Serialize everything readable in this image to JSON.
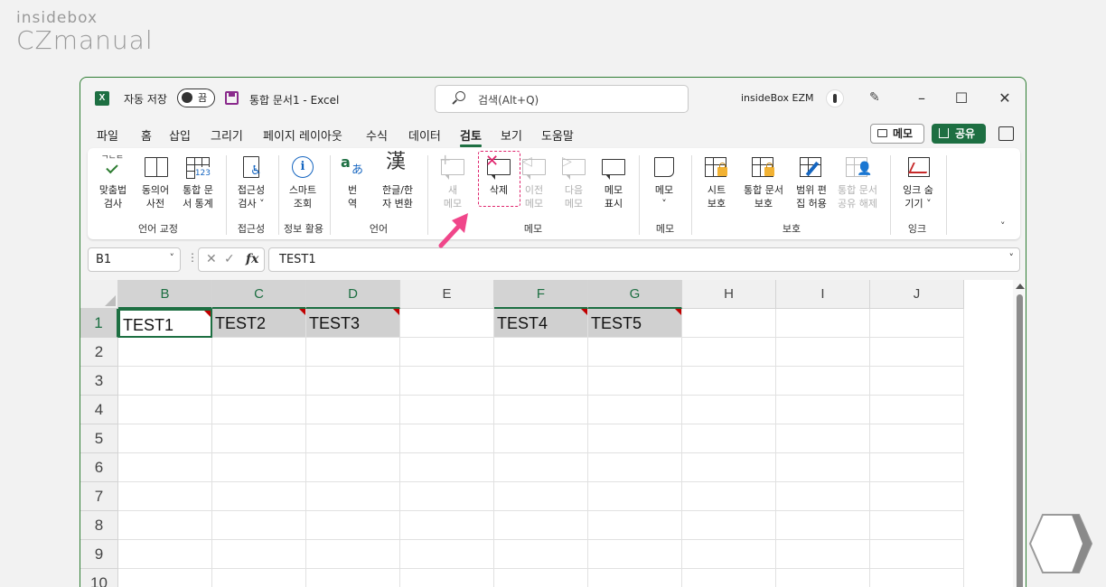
{
  "watermark": {
    "top": "insidebox",
    "main": "CZmanual"
  },
  "titlebar": {
    "app_icon": "X",
    "autosave_label": "자동 저장",
    "autosave_state": "끔",
    "doc_title": "통합 문서1  -  Excel",
    "search_placeholder": "검색(Alt+Q)",
    "user_name": "insideBox EZM",
    "minimize": "–",
    "maximize": "☐",
    "close": "✕"
  },
  "tabs": [
    "파일",
    "홈",
    "삽입",
    "그리기",
    "페이지 레이아웃",
    "수식",
    "데이터",
    "검토",
    "보기",
    "도움말"
  ],
  "active_tab": "검토",
  "header_buttons": {
    "memo": "메모",
    "share": "공유"
  },
  "ribbon": {
    "buttons": {
      "spell": [
        "맞춤법",
        "검사"
      ],
      "thesaurus": [
        "동의어",
        "사전"
      ],
      "stats": [
        "통합 문",
        "서 통계"
      ],
      "access": [
        "접근성",
        "검사 ˅"
      ],
      "smart": [
        "스마트",
        "조회"
      ],
      "translate": [
        "번",
        "역"
      ],
      "hanja": [
        "한글/한",
        "자 변환"
      ],
      "new_comment": [
        "새",
        "메모"
      ],
      "delete_comment": [
        "삭제"
      ],
      "prev_comment": [
        "이전",
        "메모"
      ],
      "next_comment": [
        "다음",
        "메모"
      ],
      "show_comments": [
        "메모",
        "표시"
      ],
      "notes": [
        "메모",
        "˅"
      ],
      "protect_sheet": [
        "시트",
        "보호"
      ],
      "protect_book": [
        "통합 문서",
        "보호"
      ],
      "allow_edit": [
        "범위 편",
        "집 허용"
      ],
      "unshare": [
        "통합 문서",
        "공유 해제"
      ],
      "hide_ink": [
        "잉크 숨",
        "기기 ˅"
      ]
    },
    "groups": {
      "proofing": "언어 교정",
      "accessibility": "접근성",
      "insights": "정보 활용",
      "language": "언어",
      "comments": "메모",
      "notes": "메모",
      "protect": "보호",
      "ink": "잉크"
    },
    "icon_text": {
      "stats_num": "123",
      "translate_a": "a",
      "translate_b": "あ",
      "hanja": "漢",
      "info": "i"
    }
  },
  "formula_bar": {
    "name_box": "B1",
    "fx": "fx",
    "content": "TEST1"
  },
  "sheet": {
    "columns": [
      "B",
      "C",
      "D",
      "E",
      "F",
      "G",
      "H",
      "I",
      "J"
    ],
    "rows": [
      "1",
      "2",
      "3",
      "4",
      "5",
      "6",
      "7",
      "8",
      "9",
      "10"
    ],
    "cells": {
      "B1": "TEST1",
      "C1": "TEST2",
      "D1": "TEST3",
      "F1": "TEST4",
      "G1": "TEST5"
    }
  },
  "colors": {
    "excel_green": "#1d6f42",
    "highlight_pink": "#e0246d",
    "comment_marker": "#c00000"
  }
}
